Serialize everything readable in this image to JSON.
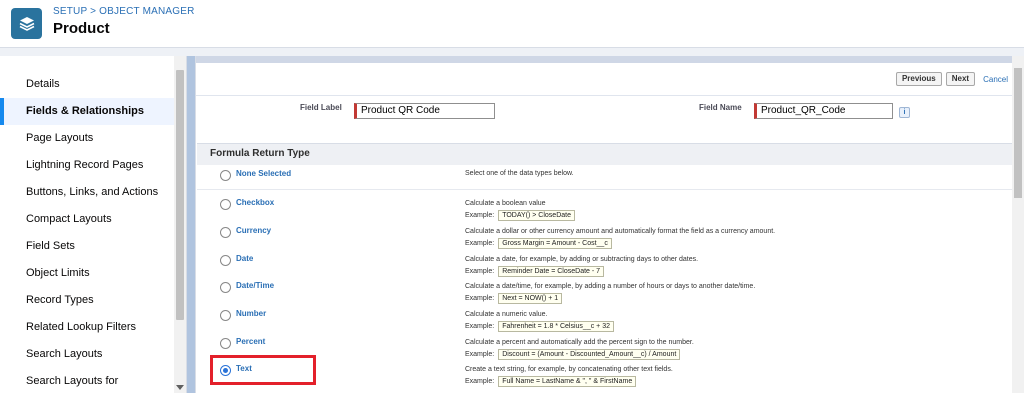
{
  "header": {
    "breadcrumb": "SETUP > OBJECT MANAGER",
    "title": "Product",
    "icon": "layers-icon"
  },
  "sidebar": {
    "items": [
      {
        "label": "Details"
      },
      {
        "label": "Fields & Relationships",
        "active": true
      },
      {
        "label": "Page Layouts"
      },
      {
        "label": "Lightning Record Pages"
      },
      {
        "label": "Buttons, Links, and Actions"
      },
      {
        "label": "Compact Layouts"
      },
      {
        "label": "Field Sets"
      },
      {
        "label": "Object Limits"
      },
      {
        "label": "Record Types"
      },
      {
        "label": "Related Lookup Filters"
      },
      {
        "label": "Search Layouts"
      },
      {
        "label": "Search Layouts for"
      }
    ]
  },
  "toolbar": {
    "previous_label": "Previous",
    "next_label": "Next",
    "cancel_label": "Cancel"
  },
  "form": {
    "field_label_label": "Field Label",
    "field_label_value": "Product QR Code",
    "field_name_label": "Field Name",
    "field_name_value": "Product_QR_Code",
    "info_icon_text": "i"
  },
  "section": {
    "title": "Formula Return Type"
  },
  "options": [
    {
      "label": "None Selected",
      "desc": "Select one of the data types below.",
      "example": ""
    },
    {
      "label": "Checkbox",
      "desc": "Calculate a boolean value",
      "example": "TODAY() > CloseDate"
    },
    {
      "label": "Currency",
      "desc": "Calculate a dollar or other currency amount and automatically format the field as a currency amount.",
      "example": "Gross Margin = Amount - Cost__c"
    },
    {
      "label": "Date",
      "desc": "Calculate a date, for example, by adding or subtracting days to other dates.",
      "example": "Reminder Date = CloseDate - 7"
    },
    {
      "label": "Date/Time",
      "desc": "Calculate a date/time, for example, by adding a number of hours or days to another date/time.",
      "example": "Next = NOW() + 1"
    },
    {
      "label": "Number",
      "desc": "Calculate a numeric value.",
      "example": "Fahrenheit = 1.8 * Celsius__c + 32"
    },
    {
      "label": "Percent",
      "desc": "Calculate a percent and automatically add the percent sign to the number.",
      "example": "Discount = (Amount - Discounted_Amount__c) / Amount"
    },
    {
      "label": "Text",
      "desc": "Create a text string, for example, by concatenating other text fields.",
      "example": "Full Name = LastName & \", \" & FirstName",
      "selected": true
    }
  ],
  "example_prefix": "Example:",
  "colors": {
    "accent": "#2a6fb5",
    "highlight": "#e3202a",
    "required": "#c23934"
  }
}
